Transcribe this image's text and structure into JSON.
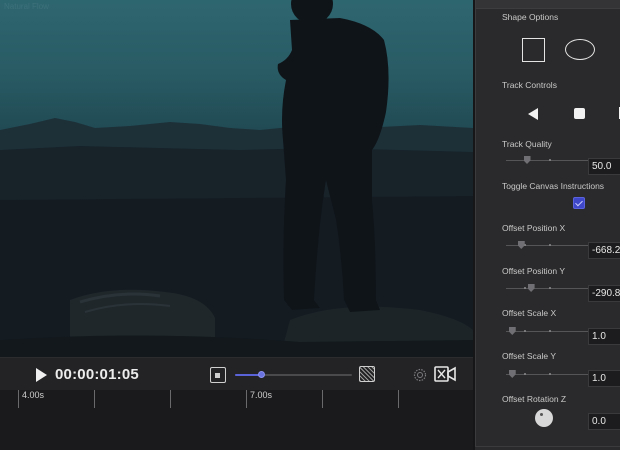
{
  "viewer": {
    "scene_label": "Natural Flow"
  },
  "transport": {
    "timecode": "00:00:01:05",
    "zoom_level": 0.22,
    "icons": [
      "play-icon",
      "zoom-out-icon",
      "zoom-in-icon",
      "snapshot-icon",
      "video-camera-icon"
    ]
  },
  "timeline": {
    "labels": [
      "4.00s",
      "7.00s"
    ]
  },
  "panel": {
    "shape_options_label": "Shape Options",
    "track_controls_label": "Track Controls",
    "track_quality": {
      "label": "Track Quality",
      "value": "50.0",
      "level": 0.25
    },
    "toggle_canvas": {
      "label": "Toggle Canvas Instructions",
      "checked": true
    },
    "offset_position_x": {
      "label": "Offset Position X",
      "value": "-668.2",
      "level": 0.18
    },
    "offset_position_y": {
      "label": "Offset Position Y",
      "value": "-290.8",
      "level": 0.3
    },
    "offset_scale_x": {
      "label": "Offset Scale X",
      "value": "1.0",
      "level": 0.07
    },
    "offset_scale_y": {
      "label": "Offset Scale Y",
      "value": "1.0",
      "level": 0.07
    },
    "offset_rotation_z": {
      "label": "Offset Rotation Z",
      "value": "0.0"
    }
  },
  "colors": {
    "accent": "#5a63d8",
    "checkbox": "#3f47c9",
    "panel_bg": "#2a2a2c",
    "timeline_bg": "#1a1a1c"
  }
}
